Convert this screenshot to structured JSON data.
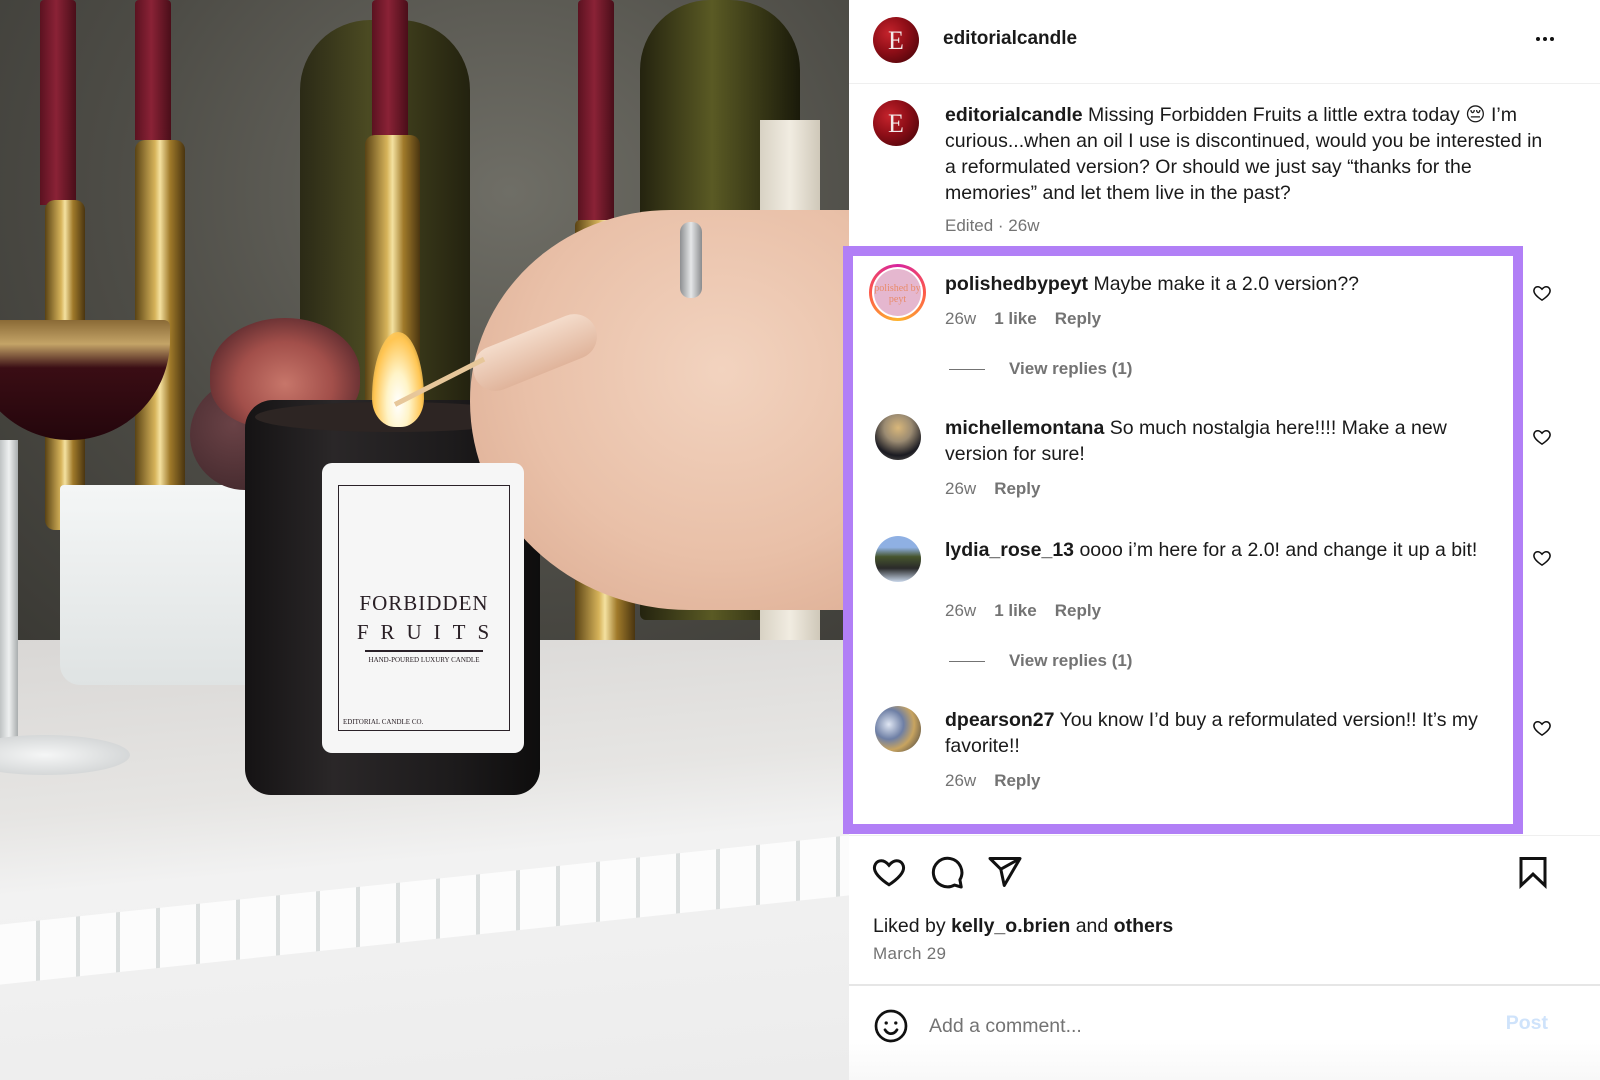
{
  "photo": {
    "alt": "Hand lighting a Forbidden Fruits candle with a match",
    "label_title_line1": "FORBIDDEN",
    "label_title_line2": "FRUITS",
    "label_subtitle": "HAND-POURED LUXURY CANDLE",
    "label_brand": "EDITORIAL CANDLE CO."
  },
  "header": {
    "avatar_letter": "E",
    "username": "editorialcandle",
    "more_icon": "more-horizontal-icon"
  },
  "caption": {
    "avatar_letter": "E",
    "username": "editorialcandle",
    "text": "Missing Forbidden Fruits a little extra today 😔 I’m curious...when an oil I use is discontinued, would you be interested in a reformulated version? Or should we just say “thanks for the memories” and let them live in the past?",
    "meta": "Edited · 26w"
  },
  "highlight": {
    "color": "#b17ff6"
  },
  "comments": [
    {
      "username": "polishedbypeyt",
      "avatar_text": "polished by peyt",
      "text": "Maybe make it a 2.0 version??",
      "age": "26w",
      "likes": "1 like",
      "reply_label": "Reply",
      "view_replies": "View replies (1)"
    },
    {
      "username": "michellemontana",
      "text": "So much nostalgia here!!!! Make a new version for sure!",
      "age": "26w",
      "reply_label": "Reply"
    },
    {
      "username": "lydia_rose_13",
      "text": "oooo i’m here for a 2.0! and change it up a bit!",
      "age": "26w",
      "likes": "1 like",
      "reply_label": "Reply",
      "view_replies": "View replies (1)"
    },
    {
      "username": "dpearson27",
      "text": "You know I’d buy a reformulated version!! It’s my favorite!!",
      "age": "26w",
      "reply_label": "Reply"
    }
  ],
  "actions": {
    "like_icon": "heart-icon",
    "comment_icon": "comment-bubble-icon",
    "share_icon": "paper-plane-icon",
    "save_icon": "bookmark-icon"
  },
  "likes": {
    "prefix": "Liked by",
    "user": "kelly_o.brien",
    "conjunction": "and",
    "others": "others"
  },
  "post_date": "March 29",
  "composer": {
    "placeholder": "Add a comment...",
    "value": "",
    "post_label": "Post",
    "emoji_icon": "smiley-icon"
  },
  "colors": {
    "text_primary": "#1a1a1a",
    "text_secondary": "#737373",
    "post_disabled": "#cfe3fb",
    "highlight_border": "#b17ff6"
  }
}
